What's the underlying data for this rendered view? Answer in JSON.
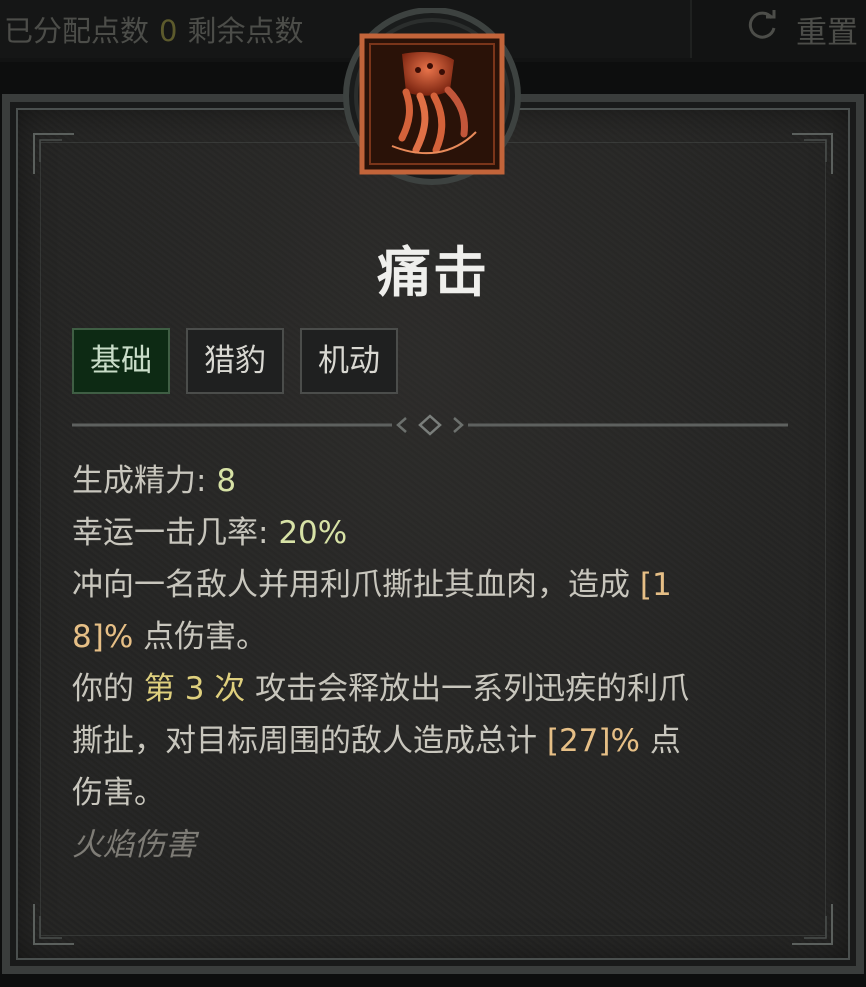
{
  "topbar": {
    "allocated_label": "已分配点数",
    "allocated_value": "0",
    "remaining_label": "剩余点数",
    "reset_label": "重置"
  },
  "skill": {
    "title": "痛击",
    "icon": "claw-icon",
    "tags": [
      "基础",
      "猎豹",
      "机动"
    ],
    "stats": {
      "spirit_label": "生成精力:",
      "spirit_value": "8",
      "crit_label": "幸运一击几率:",
      "crit_value": "20%"
    },
    "desc1_a": "冲向一名敌人并用利爪撕扯其血肉，造成",
    "desc1_b": "[1",
    "desc1_c": "8]%",
    "desc1_d": "点伤害。",
    "desc2_a": "你的",
    "desc2_b": "第 3 次",
    "desc2_c": "攻击会释放出一系列迅疾的利爪",
    "desc2_d": "撕扯，对目标周围的敌人造成总计",
    "desc2_e": "[27]%",
    "desc2_f": "点",
    "desc2_g": "伤害。",
    "damage_type": "火焰伤害"
  },
  "colors": {
    "active_tag": "#0d2a14",
    "value_green": "#d7e2a6",
    "value_orange": "#e6bf86",
    "value_yellow": "#dfd07e"
  }
}
